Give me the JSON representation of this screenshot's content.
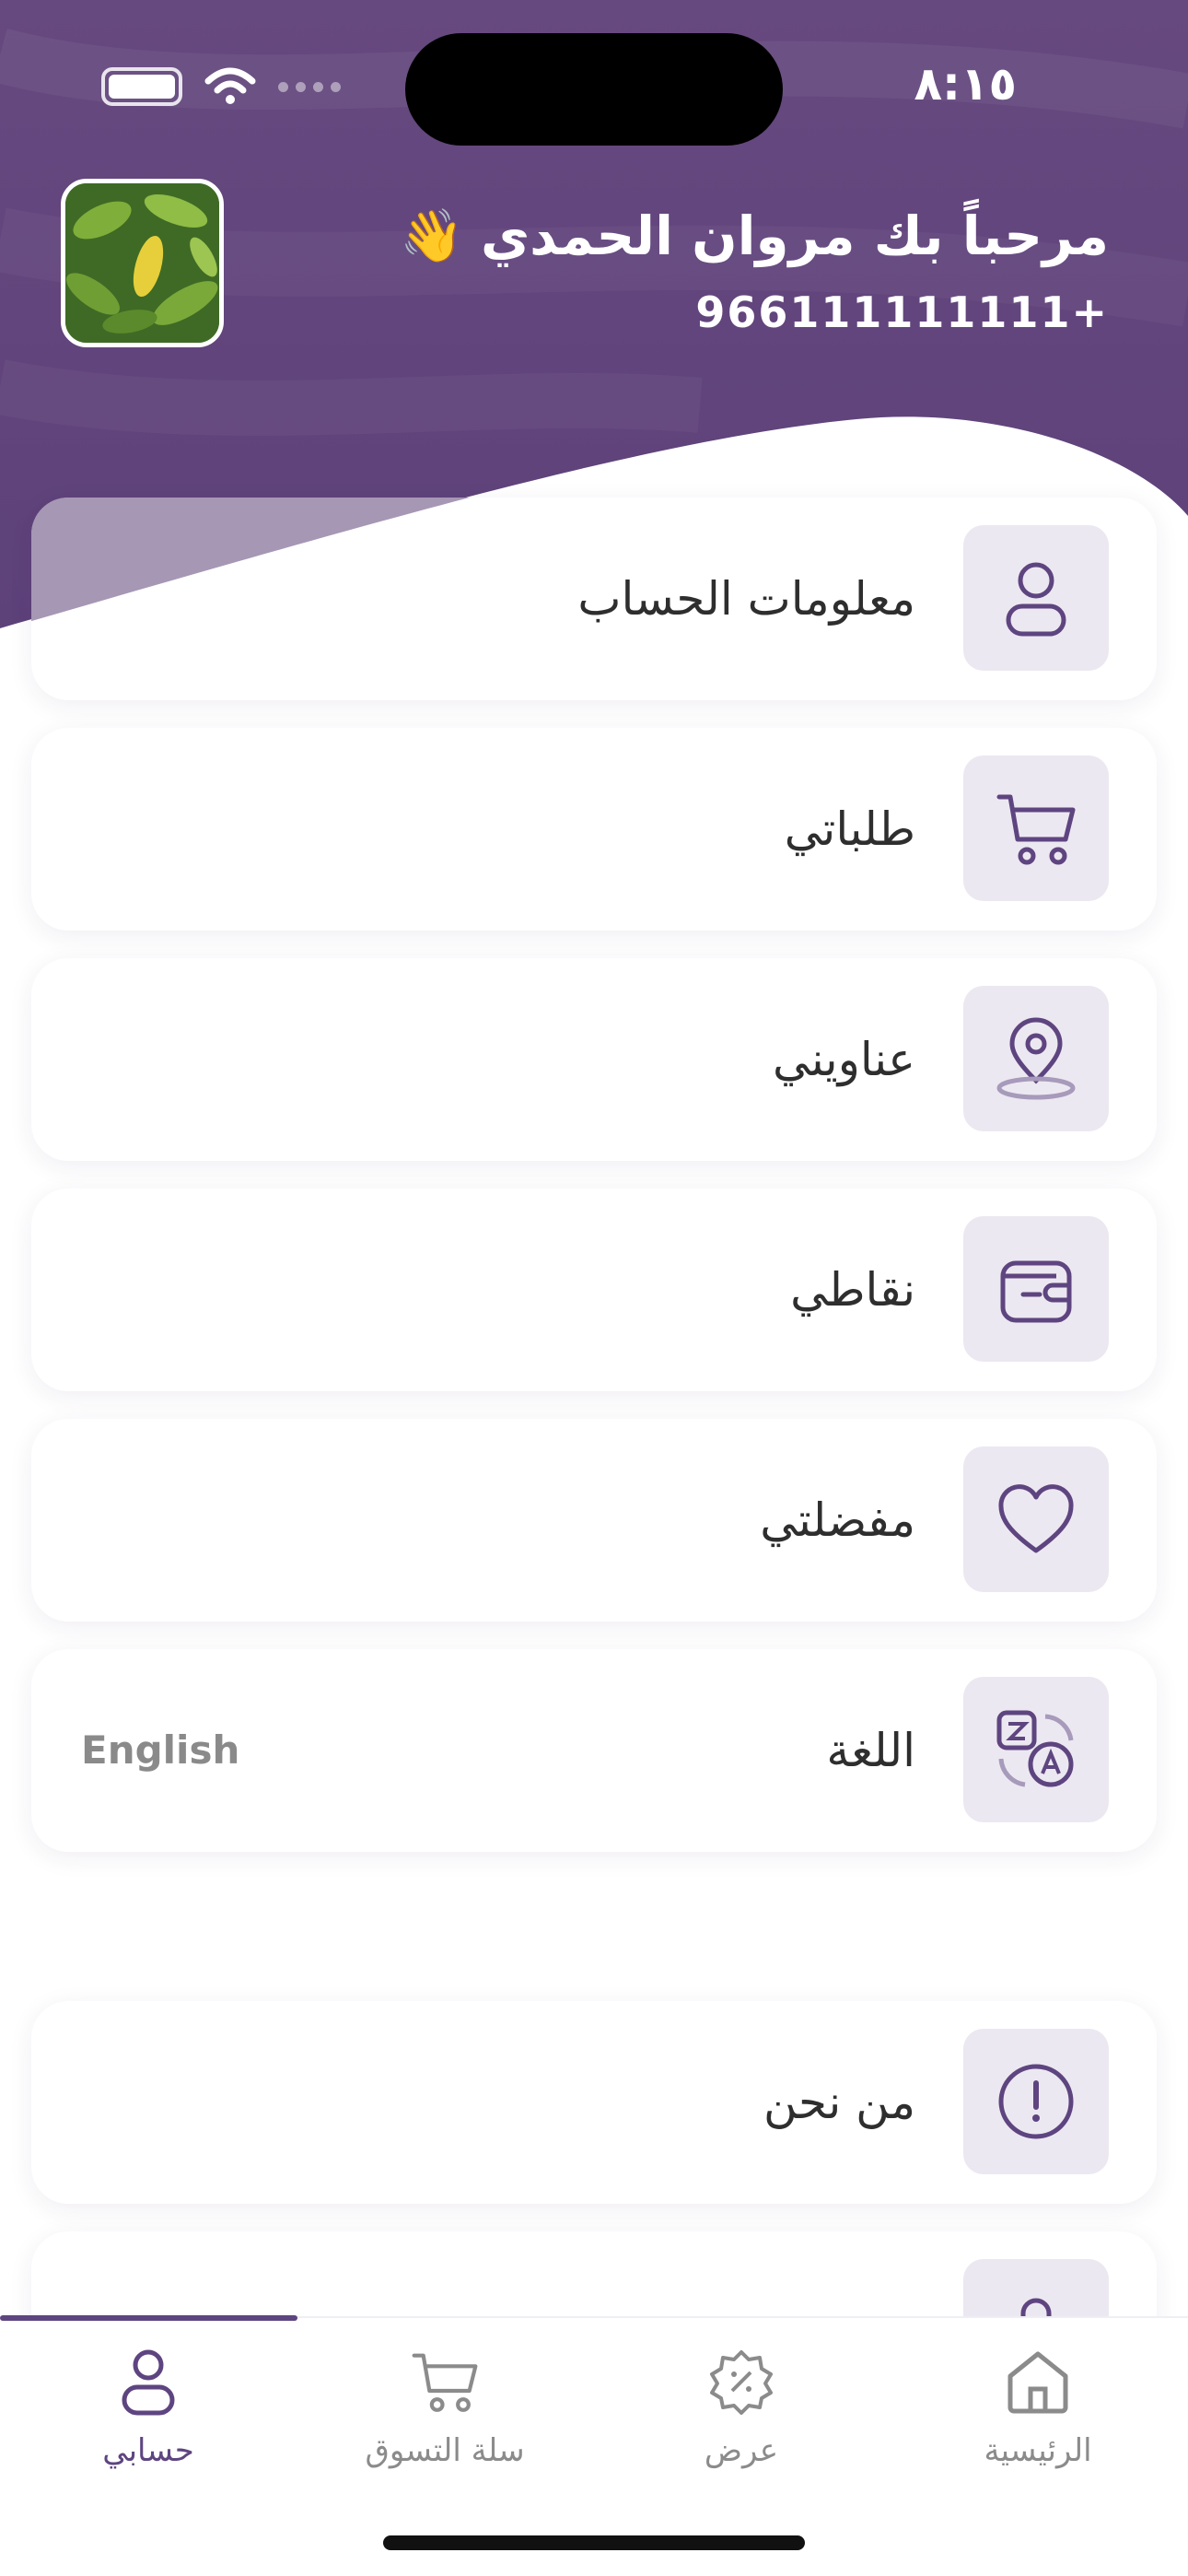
{
  "status_bar": {
    "time": "٨:١٥"
  },
  "user": {
    "greeting": "مرحباً بك مروان الحمدي",
    "wave_emoji": "👋",
    "phone": "966111111111+"
  },
  "menu": {
    "items": [
      {
        "label": "معلومات الحساب",
        "icon": "user-icon"
      },
      {
        "label": "طلباتي",
        "icon": "cart-icon"
      },
      {
        "label": "عناويني",
        "icon": "location-pin-icon"
      },
      {
        "label": "نقاطي",
        "icon": "wallet-icon"
      },
      {
        "label": "مفضلتي",
        "icon": "heart-icon"
      },
      {
        "label": "اللغة",
        "icon": "translate-icon",
        "value": "English"
      },
      {
        "label": "من نحن",
        "icon": "info-icon"
      }
    ]
  },
  "bottom_nav": {
    "items": [
      {
        "label": "حسابي",
        "icon": "user-icon",
        "active": true
      },
      {
        "label": "سلة التسوق",
        "icon": "cart-icon",
        "active": false
      },
      {
        "label": "عرض",
        "icon": "discount-badge-icon",
        "active": false
      },
      {
        "label": "الرئيسية",
        "icon": "home-icon",
        "active": false
      }
    ]
  },
  "colors": {
    "primary": "#5e4580",
    "header_bg": "#62467e",
    "icon_box_bg": "#ece8f1",
    "inactive": "#8b8b8b"
  }
}
